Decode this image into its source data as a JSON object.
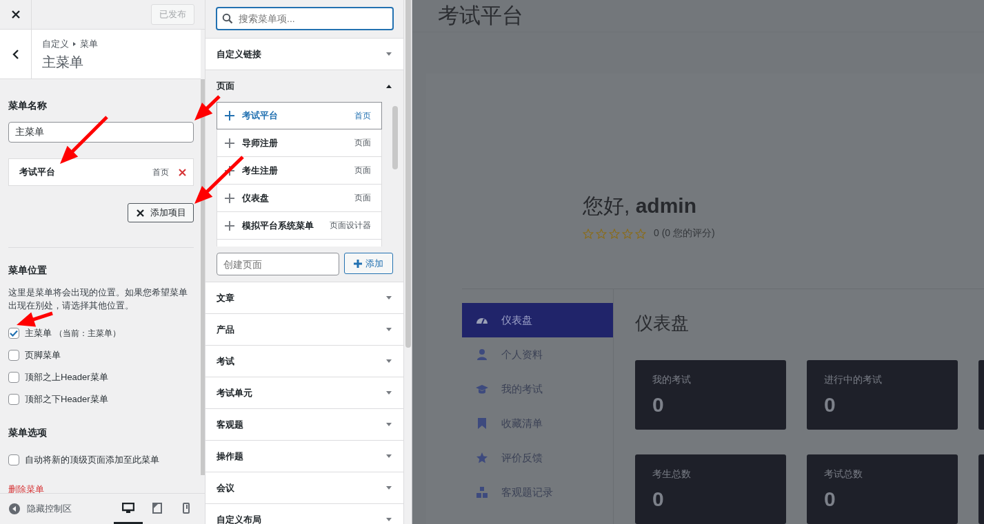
{
  "customizer": {
    "publish_button": {
      "label": "已发布",
      "disabled": true
    },
    "breadcrumb": [
      "自定义",
      "菜单"
    ],
    "title": "主菜单"
  },
  "menu_name": {
    "label": "菜单名称",
    "value": "主菜单"
  },
  "menu_items": [
    {
      "title": "考试平台",
      "type": "首页"
    }
  ],
  "add_items_button": "添加项目",
  "locations": {
    "heading": "菜单位置",
    "description": "这里是菜单将会出现的位置。如果您希望菜单出现在别处，请选择其他位置。",
    "options": [
      {
        "label": "主菜单",
        "note": "（当前：主菜单）",
        "checked": true
      },
      {
        "label": "页脚菜单",
        "checked": false
      },
      {
        "label": "顶部之上Header菜单",
        "checked": false
      },
      {
        "label": "顶部之下Header菜单",
        "checked": false
      }
    ]
  },
  "menu_options": {
    "heading": "菜单选项",
    "items": [
      {
        "label": "自动将新的顶级页面添加至此菜单",
        "checked": false
      }
    ]
  },
  "delete_link": "删除菜单",
  "footer": {
    "hide_controls": "隐藏控制区",
    "devices": [
      {
        "kind": "desktop",
        "selected": true
      },
      {
        "kind": "tablet",
        "selected": false
      },
      {
        "kind": "mobile",
        "selected": false
      }
    ]
  },
  "item_picker": {
    "search_placeholder": "搜索菜单项...",
    "sections": [
      {
        "title": "自定义链接",
        "expanded": false
      },
      {
        "title": "页面",
        "expanded": true,
        "items": [
          {
            "title": "考试平台",
            "type": "首页",
            "selected": true
          },
          {
            "title": "导师注册",
            "type": "页面",
            "selected": false
          },
          {
            "title": "考生注册",
            "type": "页面",
            "selected": false
          },
          {
            "title": "仪表盘",
            "type": "页面",
            "selected": false
          },
          {
            "title": "模拟平台系统菜单",
            "type": "页面设计器",
            "selected": false
          }
        ],
        "new_page_placeholder": "创建页面",
        "add_button": "添加"
      },
      {
        "title": "文章",
        "expanded": false
      },
      {
        "title": "产品",
        "expanded": false
      },
      {
        "title": "考试",
        "expanded": false
      },
      {
        "title": "考试单元",
        "expanded": false
      },
      {
        "title": "客观题",
        "expanded": false
      },
      {
        "title": "操作题",
        "expanded": false
      },
      {
        "title": "会议",
        "expanded": false
      },
      {
        "title": "自定义布局",
        "expanded": false
      }
    ]
  },
  "preview": {
    "site_title": "考试平台",
    "greeting": "您好, **admin**",
    "stars": 0,
    "rating": "0 (0 您的评分)",
    "nav": [
      {
        "label": "仪表盘",
        "selected": true
      },
      {
        "label": "个人资料",
        "selected": false
      },
      {
        "label": "我的考试",
        "selected": false
      },
      {
        "label": "收藏清单",
        "selected": false
      },
      {
        "label": "评价反馈",
        "selected": false
      },
      {
        "label": "客观题记录",
        "selected": false
      }
    ],
    "page_title": "仪表盘",
    "cards": [
      {
        "label": "我的考试",
        "value": "0"
      },
      {
        "label": "进行中的考试",
        "value": "0"
      },
      {
        "label": "考生总数",
        "value": "0"
      },
      {
        "label": "考试总数",
        "value": "0"
      }
    ]
  }
}
